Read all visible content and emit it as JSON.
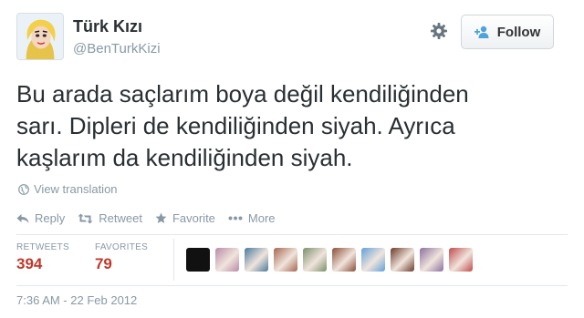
{
  "user": {
    "name": "Türk Kızı",
    "handle": "@BenTurkKizi"
  },
  "follow_button": {
    "label": "Follow"
  },
  "tweet": {
    "lines": [
      "Bu arada saçlarım boya değil kendiliğinden",
      "sarı. Dipleri de kendiliğinden siyah. Ayrıca",
      "kaşlarım da kendiliğinden siyah."
    ]
  },
  "translate": {
    "label": "View translation"
  },
  "actions": {
    "reply": "Reply",
    "retweet": "Retweet",
    "favorite": "Favorite",
    "more": "More"
  },
  "stats": {
    "retweets_label": "RETWEETS",
    "retweets_value": "394",
    "favorites_label": "FAVORITES",
    "favorites_value": "79"
  },
  "favoriters": [
    {
      "color": "#111111"
    },
    {
      "color": "#b98aa8"
    },
    {
      "color": "#4a7a9c"
    },
    {
      "color": "#a5664f"
    },
    {
      "color": "#7a8f6a"
    },
    {
      "color": "#8a4e3a"
    },
    {
      "color": "#5fa0d8"
    },
    {
      "color": "#6a3a2a"
    },
    {
      "color": "#8b6f9e"
    },
    {
      "color": "#c24a4a"
    }
  ],
  "timestamp": "7:36 AM - 22 Feb 2012",
  "colors": {
    "accent_red": "#c0392b",
    "muted_text": "#8899a6",
    "divider": "#e1e8ed"
  },
  "icons": {
    "gear": "gear-icon",
    "follow": "add-user-icon",
    "globe": "globe-icon",
    "reply": "reply-icon",
    "retweet": "retweet-icon",
    "favorite": "star-icon",
    "more": "more-icon"
  }
}
